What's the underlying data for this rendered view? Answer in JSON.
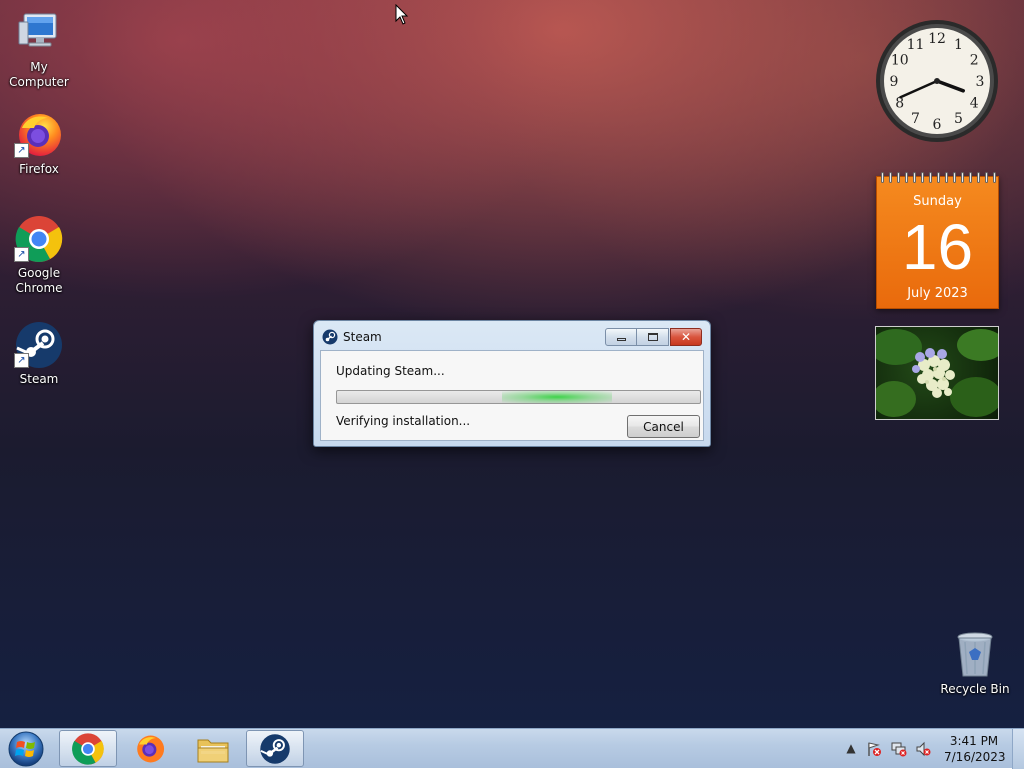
{
  "desktop": {
    "icons": [
      {
        "label": "My Computer",
        "icon": "computer-icon"
      },
      {
        "label": "Firefox",
        "icon": "firefox-icon"
      },
      {
        "label": "Google Chrome",
        "icon": "chrome-icon"
      },
      {
        "label": "Steam",
        "icon": "steam-icon"
      },
      {
        "label": "Recycle Bin",
        "icon": "recycle-bin-icon"
      }
    ]
  },
  "gadgets": {
    "clock": {
      "hour": 3,
      "minute": 41,
      "numerals": [
        "12",
        "1",
        "2",
        "3",
        "4",
        "5",
        "6",
        "7",
        "8",
        "9",
        "10",
        "11"
      ]
    },
    "calendar": {
      "weekday": "Sunday",
      "day": "16",
      "month_year": "July 2023",
      "accent": "#f07a14"
    },
    "slideshow": {
      "subject": "hydrangea flowers"
    }
  },
  "dialog": {
    "title": "Steam",
    "status": "Updating Steam...",
    "substatus": "Verifying installation...",
    "cancel_label": "Cancel",
    "progress": "indeterminate",
    "controls": {
      "minimize": "minimize-icon",
      "maximize": "maximize-icon",
      "close": "close-icon"
    }
  },
  "taskbar": {
    "start_icon": "windows-start-icon",
    "items": [
      {
        "name": "Google Chrome",
        "icon": "chrome-icon",
        "active": true
      },
      {
        "name": "Firefox",
        "icon": "firefox-icon",
        "active": false
      },
      {
        "name": "File Explorer",
        "icon": "folder-icon",
        "active": false
      },
      {
        "name": "Steam",
        "icon": "steam-icon",
        "active": true
      }
    ],
    "tray": {
      "icons": [
        "show-hidden-icons-icon",
        "action-center-alert-icon",
        "network-alert-icon",
        "volume-muted-icon"
      ],
      "time": "3:41 PM",
      "date": "7/16/2023"
    }
  },
  "colors": {
    "accent": "#f07a14",
    "progress_glow": "#3ed34a",
    "close_button": "#c7381f"
  }
}
